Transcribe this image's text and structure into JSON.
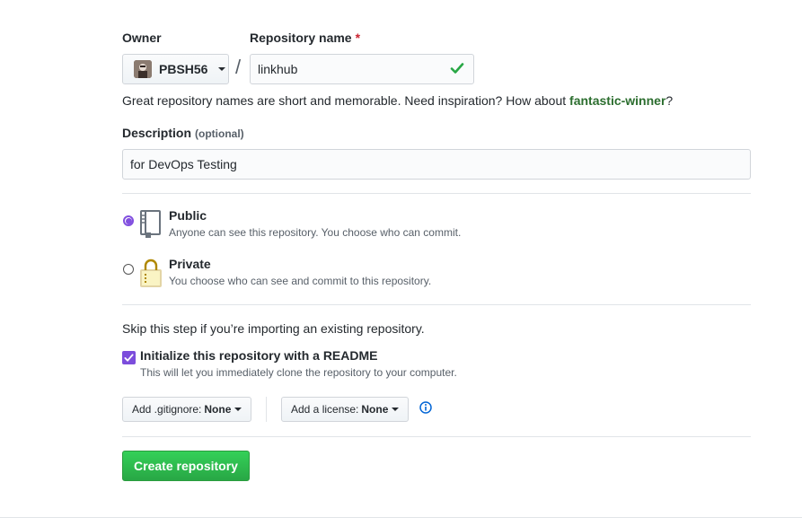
{
  "owner": {
    "label": "Owner",
    "value": "PBSH56"
  },
  "repo_name": {
    "label": "Repository name",
    "required_marker": "*",
    "value": "linkhub",
    "separator": "/"
  },
  "hint": {
    "text": "Great repository names are short and memorable. Need inspiration? How about ",
    "suggestion": "fantastic-winner",
    "suffix": "?"
  },
  "description": {
    "label": "Description",
    "optional": "(optional)",
    "value": "for DevOps Testing"
  },
  "visibility": {
    "public": {
      "title": "Public",
      "note": "Anyone can see this repository. You choose who can commit.",
      "selected": true
    },
    "private": {
      "title": "Private",
      "note": "You choose who can see and commit to this repository.",
      "selected": false
    }
  },
  "init": {
    "skip_text": "Skip this step if you’re importing an existing repository.",
    "readme_title": "Initialize this repository with a README",
    "readme_note": "This will let you immediately clone the repository to your computer.",
    "readme_checked": true
  },
  "gitignore": {
    "label": "Add .gitignore:",
    "value": "None"
  },
  "license": {
    "label": "Add a license:",
    "value": "None"
  },
  "submit": {
    "label": "Create repository"
  },
  "colors": {
    "accent_purple": "#8250df",
    "valid_green": "#28a745",
    "button_green": "#2ea44f"
  }
}
